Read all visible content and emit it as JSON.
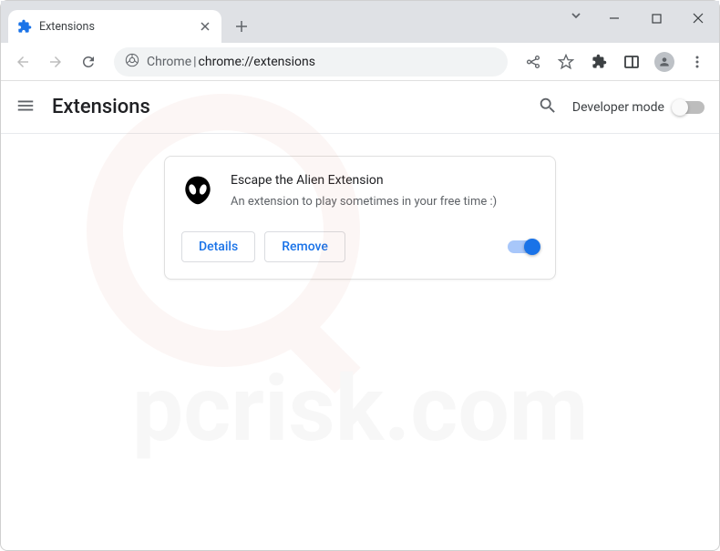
{
  "tab": {
    "title": "Extensions"
  },
  "omnibox": {
    "prefix": "Chrome",
    "separator": " | ",
    "url": "chrome://extensions"
  },
  "header": {
    "title": "Extensions",
    "dev_mode_label": "Developer mode"
  },
  "extension": {
    "name": "Escape the Alien Extension",
    "description": "An extension to play sometimes in your free time :)",
    "details_label": "Details",
    "remove_label": "Remove",
    "enabled": true
  },
  "colors": {
    "accent": "#1a73e8",
    "text_primary": "#202124",
    "text_secondary": "#5f6368"
  }
}
